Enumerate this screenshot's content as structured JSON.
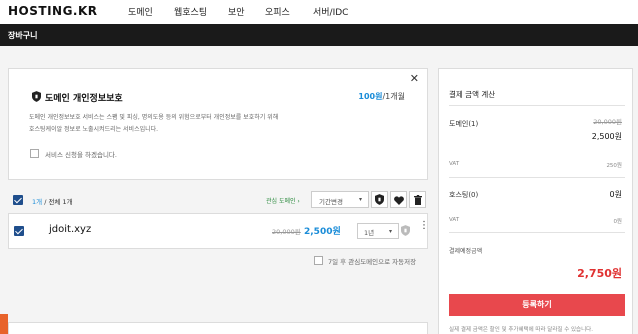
{
  "header": {
    "logo": "HOSTING.KR",
    "nav": [
      "도메인",
      "웹호스팅",
      "보안",
      "오피스",
      "서버/IDC"
    ]
  },
  "subbar": {
    "title": "장바구니"
  },
  "privacy": {
    "close": "✕",
    "title": "도메인 개인정보보호",
    "price": "100원",
    "price_unit": "/1개월",
    "description_line1": "도메인 개인정보보호 서비스는 스팸 및 피싱, 명의도용 등의 위험으로부터 개인정보를 보호하기 위해",
    "description_line2": "호스팅케이알 정보로 노출시켜드리는 서비스입니다.",
    "checkbox_label": "서비스 신청을 하겠습니다."
  },
  "cart": {
    "selected_count": "1개",
    "total_count": " / 전체 1개",
    "favorite_link": "관심 도메인 ›",
    "period_select": "기간변경",
    "items": [
      {
        "domain": "jdoit.xyz",
        "old_price": "20,000원",
        "price": "2,500원",
        "term": "1년"
      }
    ],
    "auto_move_label": "7일 후 관심도메인으로 자동저장"
  },
  "summary": {
    "title": "결제 금액 계산",
    "domain_label": "도메인(1)",
    "domain_old": "20,000원",
    "domain_price": "2,500원",
    "vat_label": "VAT",
    "domain_vat": "250원",
    "hosting_label": "호스팅(0)",
    "hosting_price": "0원",
    "hosting_vat": "0원",
    "total_label": "결제예정금액",
    "total_value": "2,750원",
    "order_button": "등록하기",
    "note": "실제 결제 금액은 할인 및 추가혜택에 따라 달라질 수 있습니다."
  },
  "colors": {
    "accent_blue": "#1a8cd8",
    "checkbox_blue": "#1f4e8c",
    "red": "#e03131",
    "button_red": "#e8484d",
    "green_link": "#2b8a3e"
  }
}
